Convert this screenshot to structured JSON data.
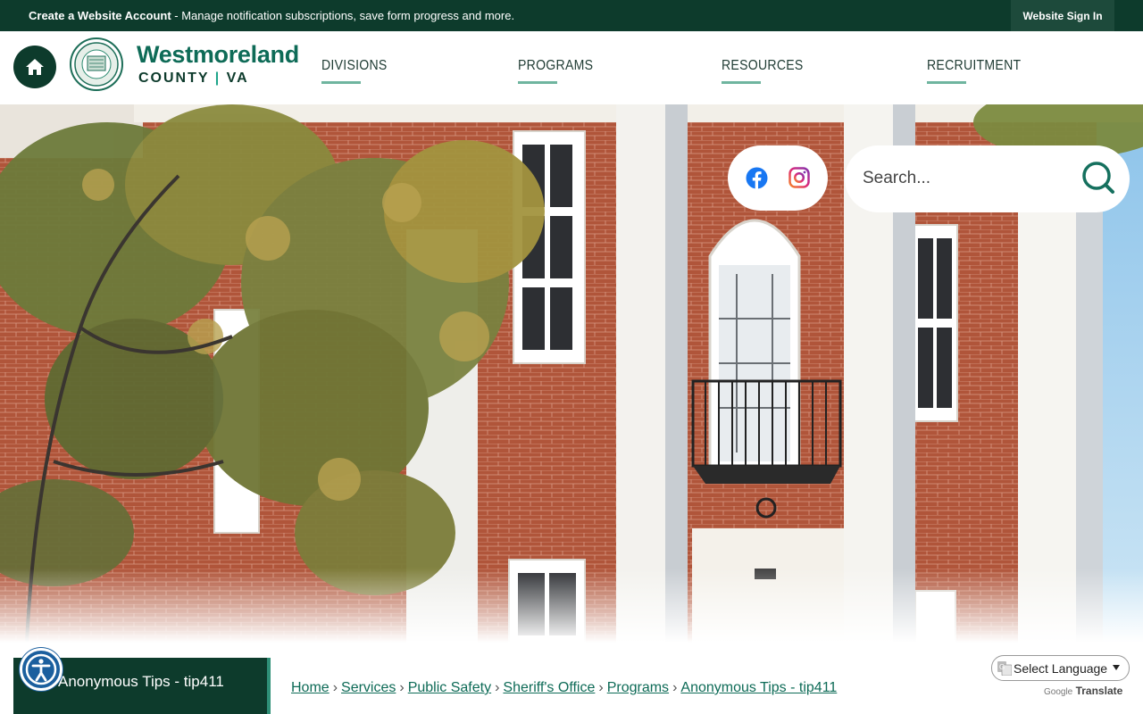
{
  "topbar": {
    "create_account": "Create a Website Account",
    "message": " - Manage notification subscriptions, save form progress and more.",
    "sign_in": "Website Sign In"
  },
  "header": {
    "brand_name": "Westmoreland",
    "brand_county": "COUNTY",
    "brand_divider": "|",
    "brand_state": "VA",
    "nav": [
      {
        "label": "DIVISIONS"
      },
      {
        "label": "PROGRAMS"
      },
      {
        "label": "RESOURCES"
      },
      {
        "label": "RECRUITMENT"
      }
    ]
  },
  "social": {
    "facebook_icon": "facebook-icon",
    "instagram_icon": "instagram-icon"
  },
  "search": {
    "placeholder": "Search..."
  },
  "page": {
    "side_title": "Anonymous Tips - tip411"
  },
  "breadcrumb": [
    {
      "label": "Home"
    },
    {
      "label": "Services"
    },
    {
      "label": "Public Safety"
    },
    {
      "label": "Sheriff's Office"
    },
    {
      "label": "Programs"
    },
    {
      "label": "Anonymous Tips - tip411"
    }
  ],
  "translate": {
    "select_label": "Select Language",
    "powered_by": "Google",
    "translate_label": "Translate"
  },
  "colors": {
    "primary_dark": "#0d3b2c",
    "accent": "#0e6b57",
    "nav_underline": "#6fb59f"
  }
}
